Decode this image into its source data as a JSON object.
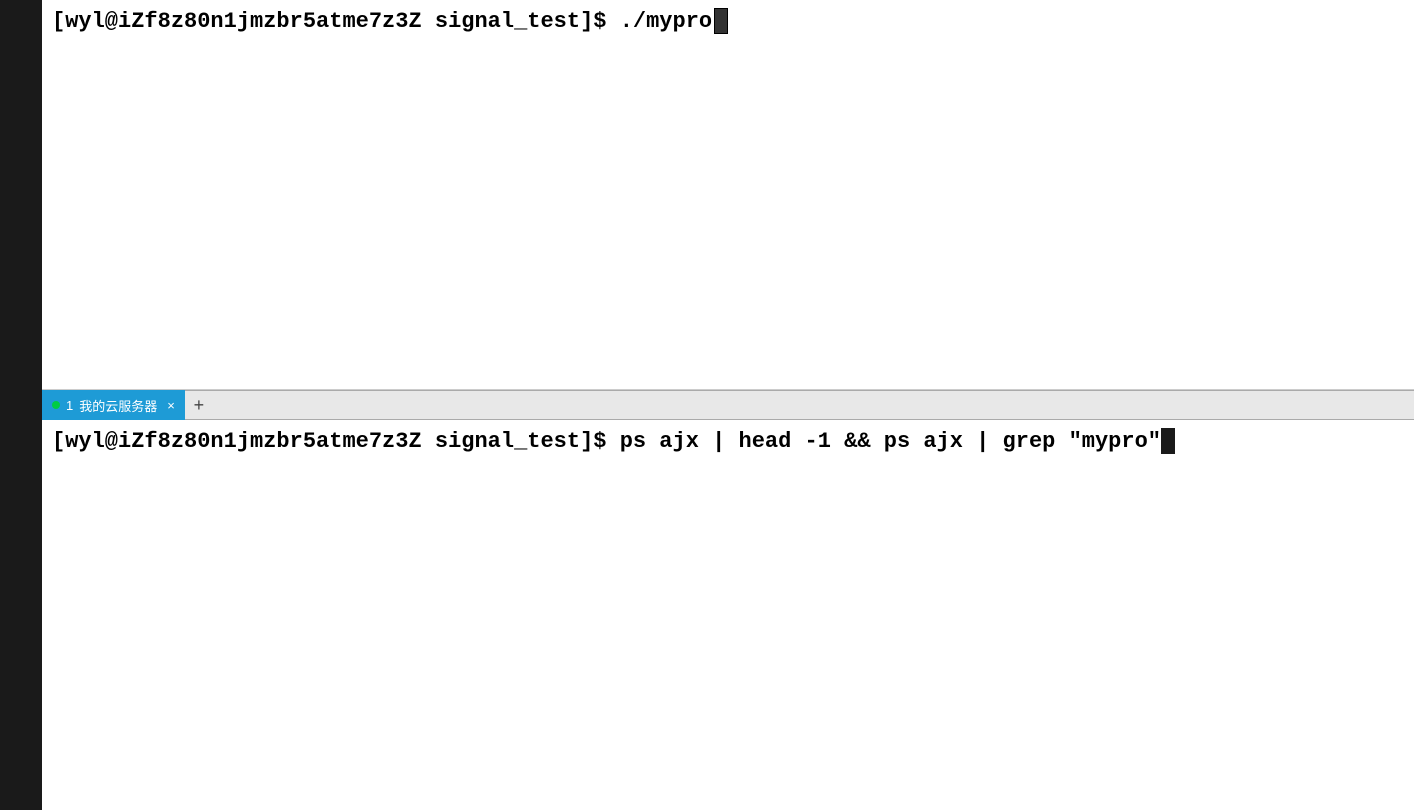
{
  "terminal": {
    "top_pane": {
      "command": "[wyl@iZf8z80n1jmzbr5atme7z3Z signal_test]$ ./mypro"
    },
    "tab_bar": {
      "tab": {
        "number": "1",
        "label": "我的云服务器",
        "close_label": "×",
        "dot_color": "#00cc44"
      },
      "add_label": "+"
    },
    "bottom_pane": {
      "command": "[wyl@iZf8z80n1jmzbr5atme7z3Z signal_test]$ ps ajx | head -1 && ps ajx | grep \"mypro\""
    }
  },
  "colors": {
    "sidebar_bg": "#1a1a1a",
    "terminal_bg": "#ffffff",
    "tab_active_bg": "#1e9bd6",
    "tab_bar_bg": "#e8e8e8",
    "text_color": "#000000",
    "cursor_color": "#1a1a1a"
  }
}
